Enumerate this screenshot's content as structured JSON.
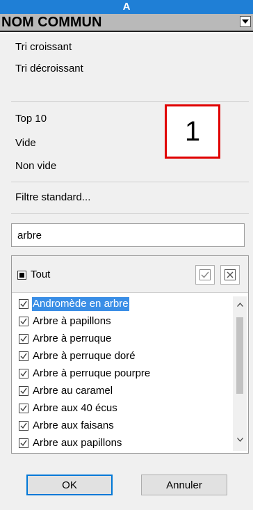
{
  "column_header": "A",
  "field_name": "NOM COMMUN",
  "sort": {
    "ascending": "Tri croissant",
    "descending": "Tri décroissant"
  },
  "filters": {
    "top10": "Top 10",
    "empty": "Vide",
    "not_empty": "Non vide",
    "standard": "Filtre standard..."
  },
  "callout_number": "1",
  "search": {
    "value": "arbre"
  },
  "all_label": "Tout",
  "items": [
    {
      "label": "Andromède en arbre",
      "checked": true,
      "selected": true
    },
    {
      "label": "Arbre à papillons",
      "checked": true
    },
    {
      "label": "Arbre à perruque",
      "checked": true
    },
    {
      "label": "Arbre à perruque doré",
      "checked": true
    },
    {
      "label": "Arbre à perruque pourpre",
      "checked": true
    },
    {
      "label": "Arbre au caramel",
      "checked": true
    },
    {
      "label": "Arbre aux 40 écus",
      "checked": true
    },
    {
      "label": "Arbre aux faisans",
      "checked": true
    },
    {
      "label": "Arbre aux papillons",
      "checked": true
    }
  ],
  "buttons": {
    "ok": "OK",
    "cancel": "Annuler"
  },
  "icons": {
    "dropdown": "chevron-down-icon",
    "check_all": "check-all-icon",
    "uncheck_all": "uncheck-all-icon",
    "scroll_up": "scroll-up-icon",
    "scroll_down": "scroll-down-icon"
  },
  "colors": {
    "header": "#1f7fd6",
    "selection": "#3a8ee6",
    "callout_border": "#e00000",
    "ok_border": "#0078d7"
  }
}
